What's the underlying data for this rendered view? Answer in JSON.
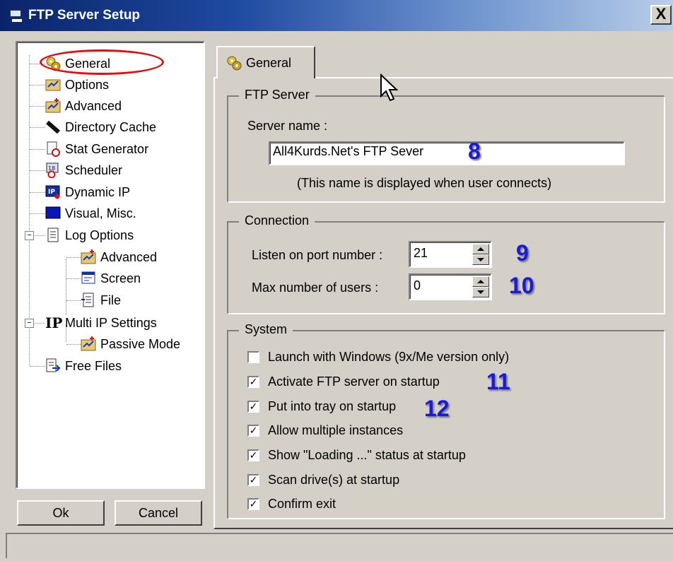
{
  "window": {
    "title": "FTP Server Setup",
    "close_label": "X"
  },
  "tree": {
    "items": [
      {
        "label": "General",
        "icon": "gears-icon"
      },
      {
        "label": "Options",
        "icon": "options-icon"
      },
      {
        "label": "Advanced",
        "icon": "advanced-icon"
      },
      {
        "label": "Directory Cache",
        "icon": "cache-icon"
      },
      {
        "label": "Stat Generator",
        "icon": "stat-icon"
      },
      {
        "label": "Scheduler",
        "icon": "calendar-icon"
      },
      {
        "label": "Dynamic IP",
        "icon": "ip-icon"
      },
      {
        "label": "Visual, Misc.",
        "icon": "monitor-icon"
      },
      {
        "label": "Log Options",
        "icon": "log-icon"
      },
      {
        "label": "Advanced",
        "icon": "advanced-icon"
      },
      {
        "label": "Screen",
        "icon": "screen-icon"
      },
      {
        "label": "File",
        "icon": "file-icon"
      },
      {
        "label": "Multi IP Settings",
        "icon": "ip-bold-icon"
      },
      {
        "label": "Passive Mode",
        "icon": "advanced-icon"
      },
      {
        "label": "Free Files",
        "icon": "free-files-icon"
      }
    ]
  },
  "buttons": {
    "ok": "Ok",
    "cancel": "Cancel"
  },
  "tab": {
    "label": "General"
  },
  "ftp_server": {
    "legend": "FTP Server",
    "server_name_label": "Server name :",
    "server_name_value": "All4Kurds.Net's FTP Sever",
    "hint": "(This name is displayed when user connects)"
  },
  "connection": {
    "legend": "Connection",
    "port_label": "Listen on port number :",
    "port_value": "21",
    "max_users_label": "Max number of users :",
    "max_users_value": "0"
  },
  "system": {
    "legend": "System",
    "options": [
      {
        "label": "Launch with Windows (9x/Me version only)",
        "checked": false
      },
      {
        "label": "Activate FTP server on startup",
        "checked": true
      },
      {
        "label": "Put into tray on startup",
        "checked": true
      },
      {
        "label": "Allow multiple instances",
        "checked": true
      },
      {
        "label": "Show \"Loading ...\" status at startup",
        "checked": true
      },
      {
        "label": "Scan drive(s) at startup",
        "checked": true
      },
      {
        "label": "Confirm exit",
        "checked": true
      }
    ]
  },
  "annotations": {
    "a8": "8",
    "a9": "9",
    "a10": "10",
    "a11": "11",
    "a12": "12"
  },
  "colors": {
    "annotation": "#1a1adc",
    "highlight_circle": "#e01010",
    "title_start": "#0a246a",
    "title_end": "#b9cde9"
  }
}
